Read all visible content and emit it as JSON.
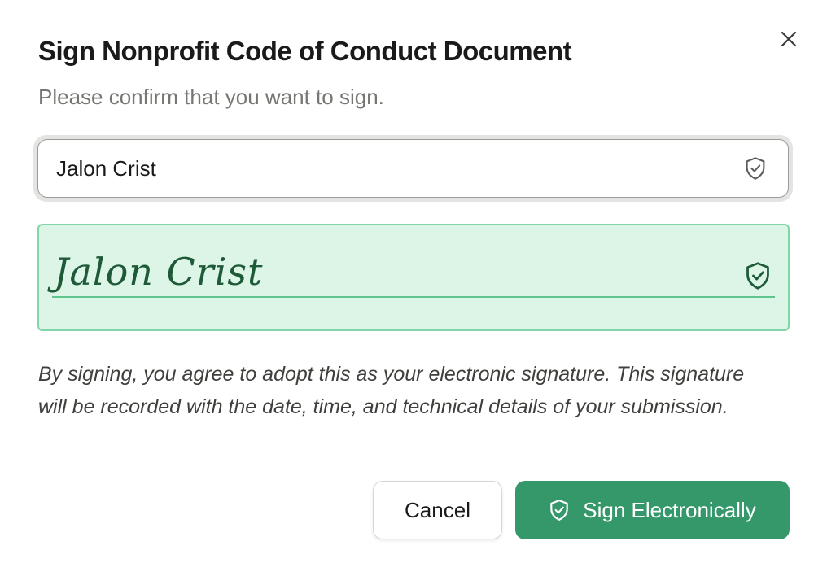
{
  "dialog": {
    "title": "Sign Nonprofit Code of Conduct Document",
    "subtitle": "Please confirm that you want to sign.",
    "close_icon": "close-icon"
  },
  "name_field": {
    "value": "Jalon Crist",
    "icon": "shield-check-icon"
  },
  "signature_preview": {
    "text": "Jalon Crist",
    "icon": "shield-check-icon"
  },
  "disclaimer": "By signing, you agree to adopt this as your electronic signature. This signature will be recorded with the date, time, and technical details of your submission.",
  "actions": {
    "cancel_label": "Cancel",
    "sign_label": "Sign Electronically",
    "sign_icon": "shield-check-icon"
  },
  "colors": {
    "accent": "#35986b",
    "signature_bg": "#dcf5e6",
    "signature_border": "#7fd6a7",
    "signature_ink": "#1e5a38"
  }
}
